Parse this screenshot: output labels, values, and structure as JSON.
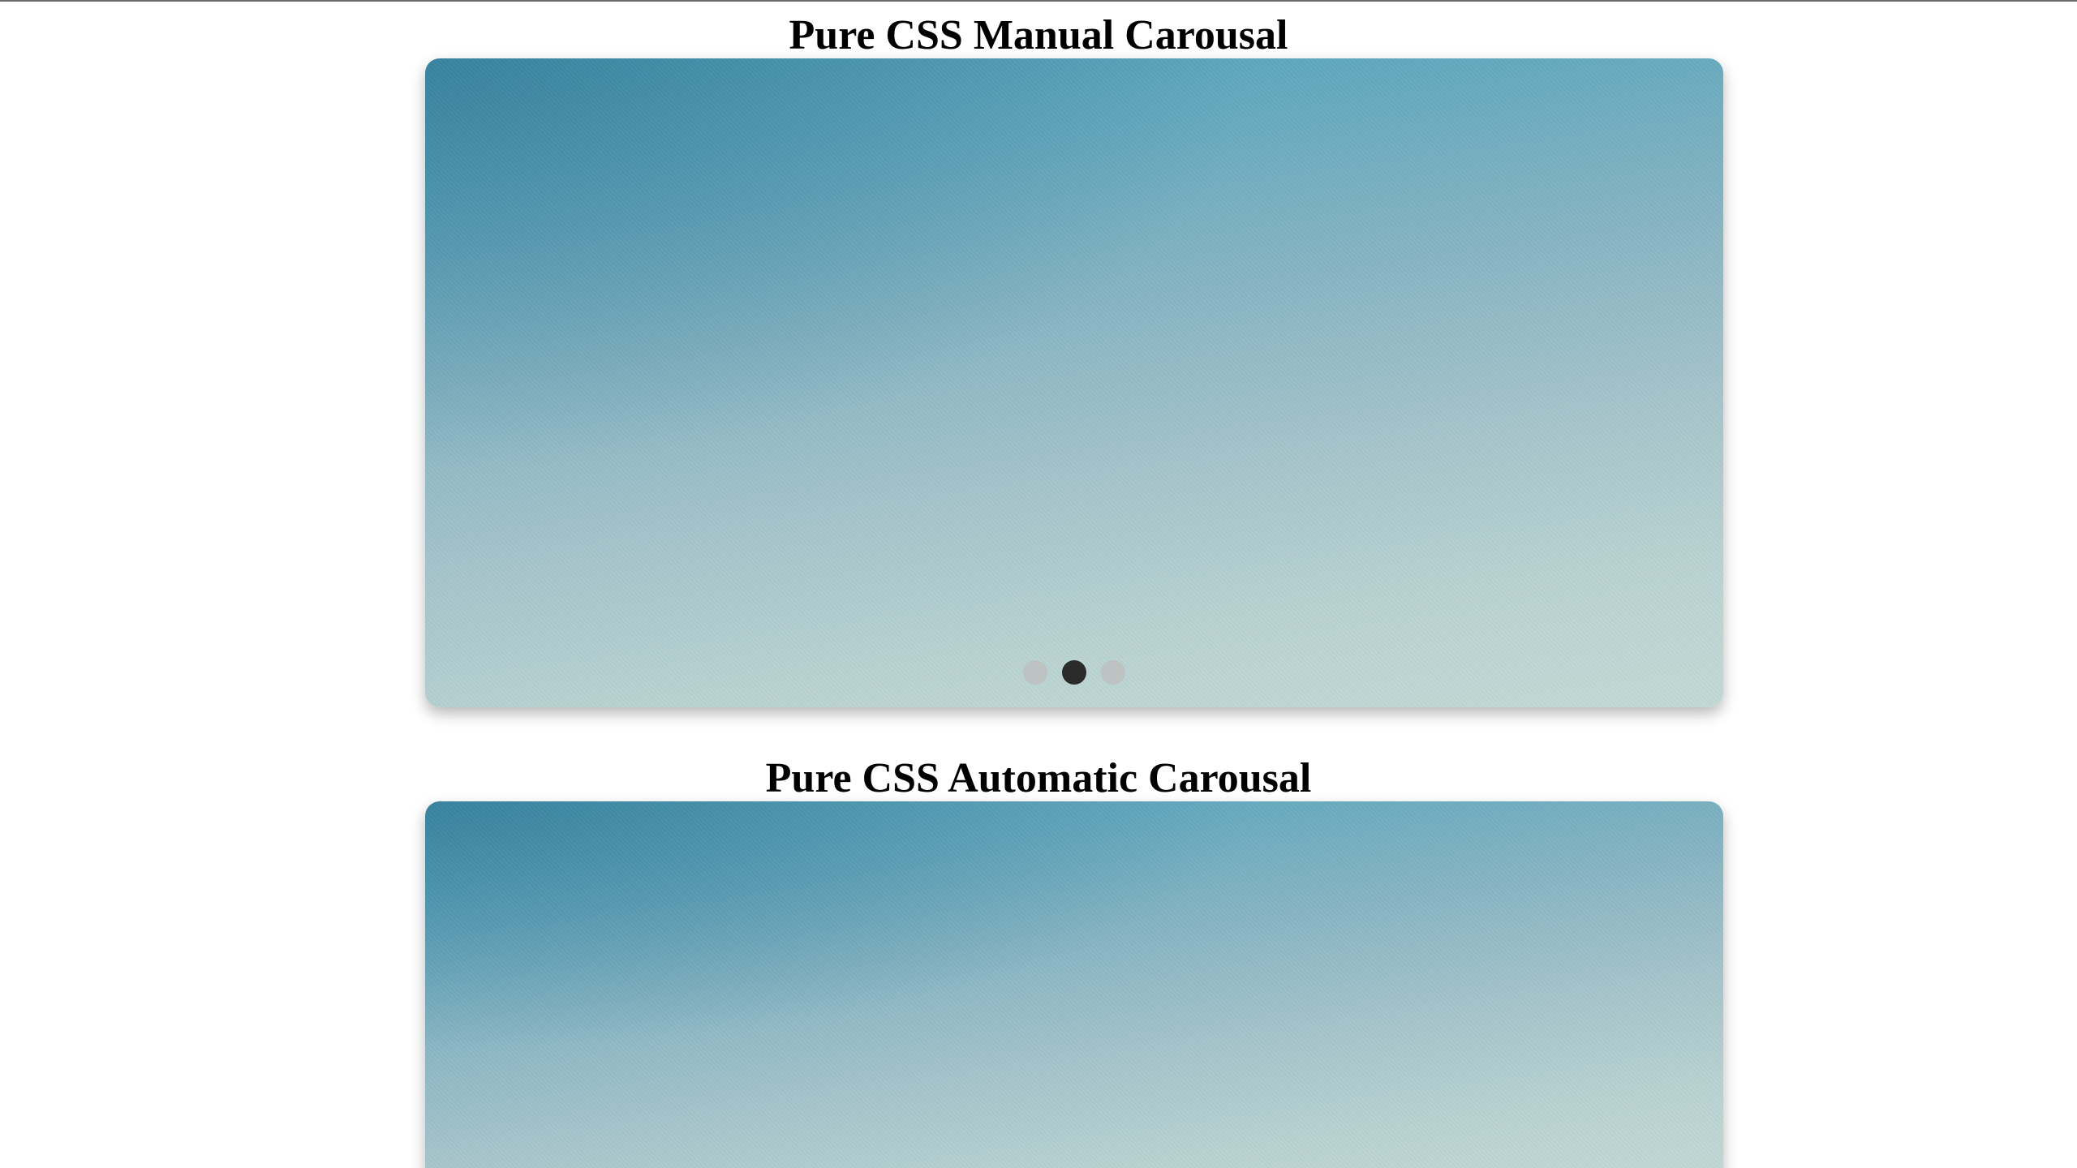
{
  "manual_carousel": {
    "title": "Pure CSS Manual Carousal",
    "slides": 3,
    "active_slide": 2,
    "dots": [
      {
        "label": "slide-1",
        "active": false
      },
      {
        "label": "slide-2",
        "active": true
      },
      {
        "label": "slide-3",
        "active": false
      }
    ]
  },
  "automatic_carousel": {
    "title": "Pure CSS Automatic Carousal"
  },
  "colors": {
    "background": "#ffffff",
    "active_dot": "#2b2b2b",
    "inactive_dot": "#bebebe",
    "slide_top": "#4d9db6",
    "slide_bottom": "#c3d9d5"
  }
}
